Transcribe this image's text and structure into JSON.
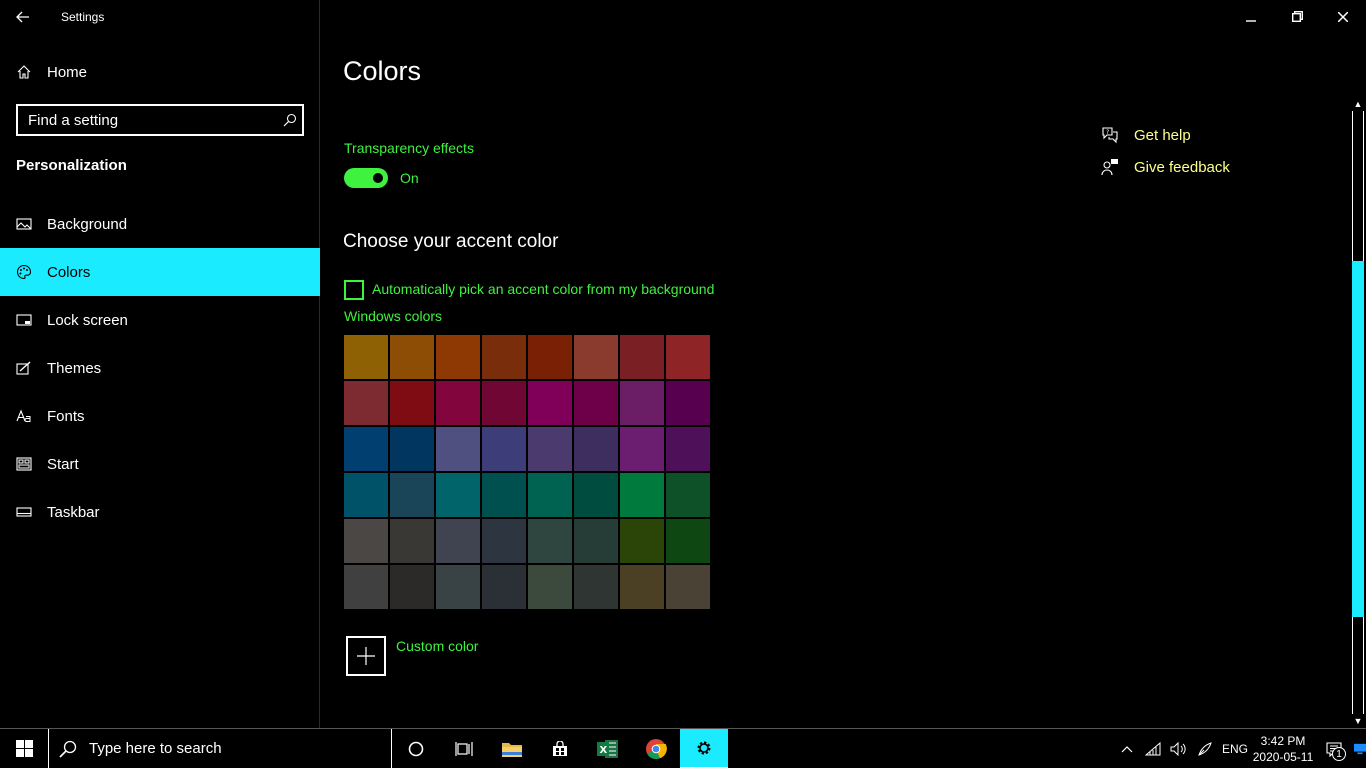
{
  "window": {
    "title": "Settings"
  },
  "sidebar": {
    "home_label": "Home",
    "search_placeholder": "Find a setting",
    "section_title": "Personalization",
    "items": [
      {
        "label": "Background",
        "icon": "image-icon"
      },
      {
        "label": "Colors",
        "icon": "palette-icon",
        "selected": true
      },
      {
        "label": "Lock screen",
        "icon": "lock-screen-icon"
      },
      {
        "label": "Themes",
        "icon": "brush-icon"
      },
      {
        "label": "Fonts",
        "icon": "font-icon"
      },
      {
        "label": "Start",
        "icon": "start-icon"
      },
      {
        "label": "Taskbar",
        "icon": "taskbar-icon"
      }
    ]
  },
  "main": {
    "title": "Colors",
    "transparency_label": "Transparency effects",
    "transparency_state": "On",
    "accent_heading": "Choose your accent color",
    "auto_pick_label": "Automatically pick an accent color from my background",
    "windows_colors_label": "Windows colors",
    "custom_color_label": "Custom color",
    "swatches": [
      "#8e6204",
      "#8e4d04",
      "#8e3804",
      "#7a2d0a",
      "#7a2004",
      "#8a3b2e",
      "#7a1f23",
      "#8f2427",
      "#7d2b30",
      "#7f0c12",
      "#82063d",
      "#700633",
      "#800059",
      "#6e0049",
      "#6b1e66",
      "#580050",
      "#003f6f",
      "#00365f",
      "#4f4f80",
      "#3d3d7a",
      "#4a3a6e",
      "#3e2e60",
      "#6b1e70",
      "#4e1058",
      "#005268",
      "#1a4558",
      "#00646a",
      "#00504f",
      "#006250",
      "#004d40",
      "#007a3d",
      "#0e5028",
      "#4a4744",
      "#393835",
      "#404450",
      "#2c3540",
      "#2e463f",
      "#263d37",
      "#2b4508",
      "#0e4712",
      "#404040",
      "#2b2a28",
      "#394244",
      "#2a3035",
      "#3b4a3c",
      "#2f3532",
      "#4c4024",
      "#4a4235"
    ]
  },
  "help": {
    "get_help": "Get help",
    "give_feedback": "Give feedback"
  },
  "taskbar": {
    "search_placeholder": "Type here to search",
    "language": "ENG",
    "time": "3:42 PM",
    "date": "2020-05-11",
    "notification_count": "1"
  },
  "colors": {
    "accent": "#1aebff",
    "green_text": "#3ff23f",
    "link_yellow": "#ffff8c"
  }
}
